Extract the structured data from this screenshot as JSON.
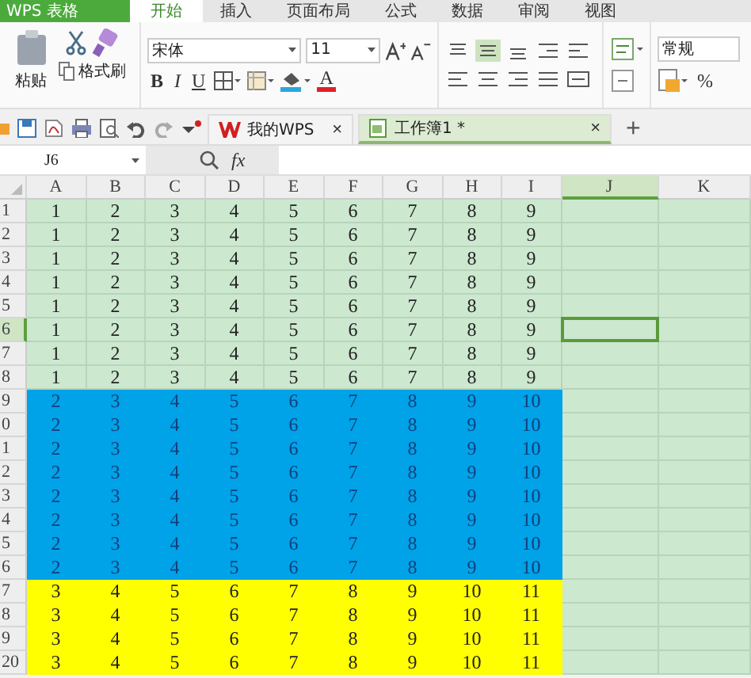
{
  "app_button": {
    "label": "WPS 表格"
  },
  "ribbon_tabs": [
    {
      "label": "开始",
      "selected": true
    },
    {
      "label": "插入",
      "selected": false
    },
    {
      "label": "页面布局",
      "selected": false
    },
    {
      "label": "公式",
      "selected": false
    },
    {
      "label": "数据",
      "selected": false
    },
    {
      "label": "审阅",
      "selected": false
    },
    {
      "label": "视图",
      "selected": false
    }
  ],
  "ribbon": {
    "paste_label": "粘贴",
    "format_painter_label": "格式刷",
    "font_name": "宋体",
    "font_size": "11",
    "bold": "B",
    "italic": "I",
    "underline": "U",
    "font_color": "A",
    "number_format": "常规",
    "percent": "%"
  },
  "doc_tabs": [
    {
      "label": "我的WPS",
      "selected": false,
      "close": "×"
    },
    {
      "label": "工作簿1 *",
      "selected": true,
      "close": "×"
    }
  ],
  "new_tab": "+",
  "formula_bar": {
    "name_box": "J6",
    "fx": "fx"
  },
  "sheet": {
    "columns": [
      {
        "label": "A",
        "selected": false
      },
      {
        "label": "B",
        "selected": false
      },
      {
        "label": "C",
        "selected": false
      },
      {
        "label": "D",
        "selected": false
      },
      {
        "label": "E",
        "selected": false
      },
      {
        "label": "F",
        "selected": false
      },
      {
        "label": "G",
        "selected": false
      },
      {
        "label": "H",
        "selected": false
      },
      {
        "label": "I",
        "selected": false
      },
      {
        "label": "J",
        "selected": true
      },
      {
        "label": "K",
        "selected": false
      }
    ],
    "rows": [
      {
        "header": "1",
        "selected": false,
        "color": "#cce8cf",
        "cells": [
          "1",
          "2",
          "3",
          "4",
          "5",
          "6",
          "7",
          "8",
          "9"
        ]
      },
      {
        "header": "2",
        "selected": false,
        "color": "#cce8cf",
        "cells": [
          "1",
          "2",
          "3",
          "4",
          "5",
          "6",
          "7",
          "8",
          "9"
        ]
      },
      {
        "header": "3",
        "selected": false,
        "color": "#cce8cf",
        "cells": [
          "1",
          "2",
          "3",
          "4",
          "5",
          "6",
          "7",
          "8",
          "9"
        ]
      },
      {
        "header": "4",
        "selected": false,
        "color": "#cce8cf",
        "cells": [
          "1",
          "2",
          "3",
          "4",
          "5",
          "6",
          "7",
          "8",
          "9"
        ]
      },
      {
        "header": "5",
        "selected": false,
        "color": "#cce8cf",
        "cells": [
          "1",
          "2",
          "3",
          "4",
          "5",
          "6",
          "7",
          "8",
          "9"
        ]
      },
      {
        "header": "6",
        "selected": true,
        "color": "#cce8cf",
        "cells": [
          "1",
          "2",
          "3",
          "4",
          "5",
          "6",
          "7",
          "8",
          "9"
        ]
      },
      {
        "header": "7",
        "selected": false,
        "color": "#cce8cf",
        "cells": [
          "1",
          "2",
          "3",
          "4",
          "5",
          "6",
          "7",
          "8",
          "9"
        ]
      },
      {
        "header": "8",
        "selected": false,
        "color": "#cce8cf",
        "cells": [
          "1",
          "2",
          "3",
          "4",
          "5",
          "6",
          "7",
          "8",
          "9"
        ]
      },
      {
        "header": "9",
        "selected": false,
        "color": "#00a2e8",
        "cells": [
          "2",
          "3",
          "4",
          "5",
          "6",
          "7",
          "8",
          "9",
          "10"
        ]
      },
      {
        "header": "0",
        "selected": false,
        "color": "#00a2e8",
        "cells": [
          "2",
          "3",
          "4",
          "5",
          "6",
          "7",
          "8",
          "9",
          "10"
        ]
      },
      {
        "header": "1",
        "selected": false,
        "color": "#00a2e8",
        "cells": [
          "2",
          "3",
          "4",
          "5",
          "6",
          "7",
          "8",
          "9",
          "10"
        ]
      },
      {
        "header": "2",
        "selected": false,
        "color": "#00a2e8",
        "cells": [
          "2",
          "3",
          "4",
          "5",
          "6",
          "7",
          "8",
          "9",
          "10"
        ]
      },
      {
        "header": "3",
        "selected": false,
        "color": "#00a2e8",
        "cells": [
          "2",
          "3",
          "4",
          "5",
          "6",
          "7",
          "8",
          "9",
          "10"
        ]
      },
      {
        "header": "4",
        "selected": false,
        "color": "#00a2e8",
        "cells": [
          "2",
          "3",
          "4",
          "5",
          "6",
          "7",
          "8",
          "9",
          "10"
        ]
      },
      {
        "header": "5",
        "selected": false,
        "color": "#00a2e8",
        "cells": [
          "2",
          "3",
          "4",
          "5",
          "6",
          "7",
          "8",
          "9",
          "10"
        ]
      },
      {
        "header": "6",
        "selected": false,
        "color": "#00a2e8",
        "cells": [
          "2",
          "3",
          "4",
          "5",
          "6",
          "7",
          "8",
          "9",
          "10"
        ]
      },
      {
        "header": "7",
        "selected": false,
        "color": "#ffff00",
        "cells": [
          "3",
          "4",
          "5",
          "6",
          "7",
          "8",
          "9",
          "10",
          "11"
        ]
      },
      {
        "header": "8",
        "selected": false,
        "color": "#ffff00",
        "cells": [
          "3",
          "4",
          "5",
          "6",
          "7",
          "8",
          "9",
          "10",
          "11"
        ]
      },
      {
        "header": "9",
        "selected": false,
        "color": "#ffff00",
        "cells": [
          "3",
          "4",
          "5",
          "6",
          "7",
          "8",
          "9",
          "10",
          "11"
        ]
      },
      {
        "header": "20",
        "selected": false,
        "color": "#ffff00",
        "cells": [
          "3",
          "4",
          "5",
          "6",
          "7",
          "8",
          "9",
          "10",
          "11"
        ]
      }
    ]
  }
}
